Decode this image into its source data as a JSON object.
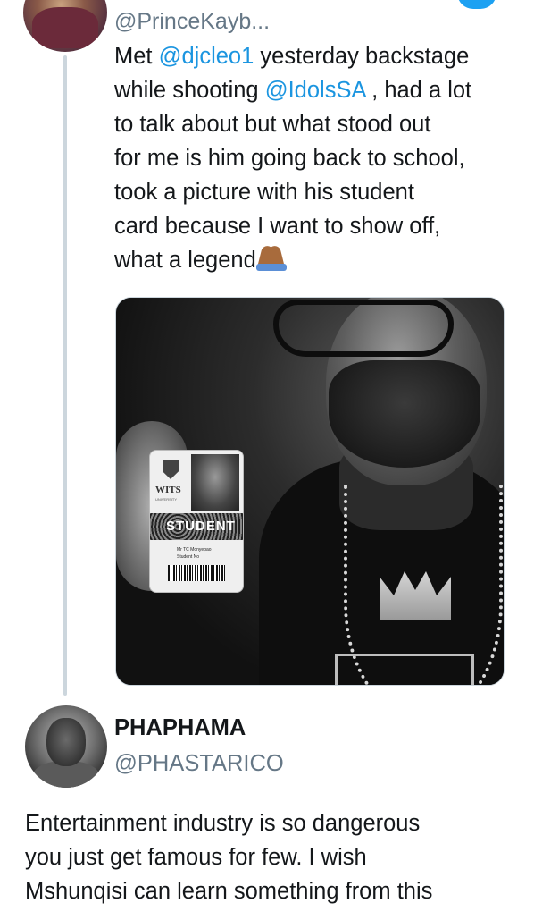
{
  "tweet": {
    "handle": "@PrinceKayb...",
    "lines": [
      {
        "pre": "Met ",
        "mention": "@djcleo1",
        "post": " yesterday backstage"
      },
      {
        "pre": "while shooting ",
        "mention": "@IdolsSA",
        "post": " , had a lot"
      },
      {
        "pre": "to talk about but what stood out",
        "mention": "",
        "post": ""
      },
      {
        "pre": "for me is him going back to school,",
        "mention": "",
        "post": ""
      },
      {
        "pre": "took a picture with his student",
        "mention": "",
        "post": ""
      },
      {
        "pre": "card because I want to show off,",
        "mention": "",
        "post": ""
      },
      {
        "pre": "what a legend",
        "mention": "",
        "post": ""
      }
    ],
    "emoji": "folded-hands-emoji",
    "photo": {
      "card_logo": "WITS",
      "card_university": "UNIVERSITY",
      "card_label": "STUDENT",
      "card_name": "Mr TC Monyepao",
      "card_number": "Student No"
    }
  },
  "reply": {
    "name": "PHAPHAMA",
    "handle": "@PHASTARICO",
    "lines": [
      "Entertainment industry is so dangerous",
      "you just get famous for few. I wish",
      "Mshunqisi can learn something from this"
    ]
  },
  "colors": {
    "mention": "#1b95e0",
    "handle": "#657786",
    "text": "#14171a",
    "thread_line": "#ccd6dd",
    "twitter_blue": "#1da1f2"
  },
  "icons": {
    "twitter": "twitter-bird-icon"
  }
}
